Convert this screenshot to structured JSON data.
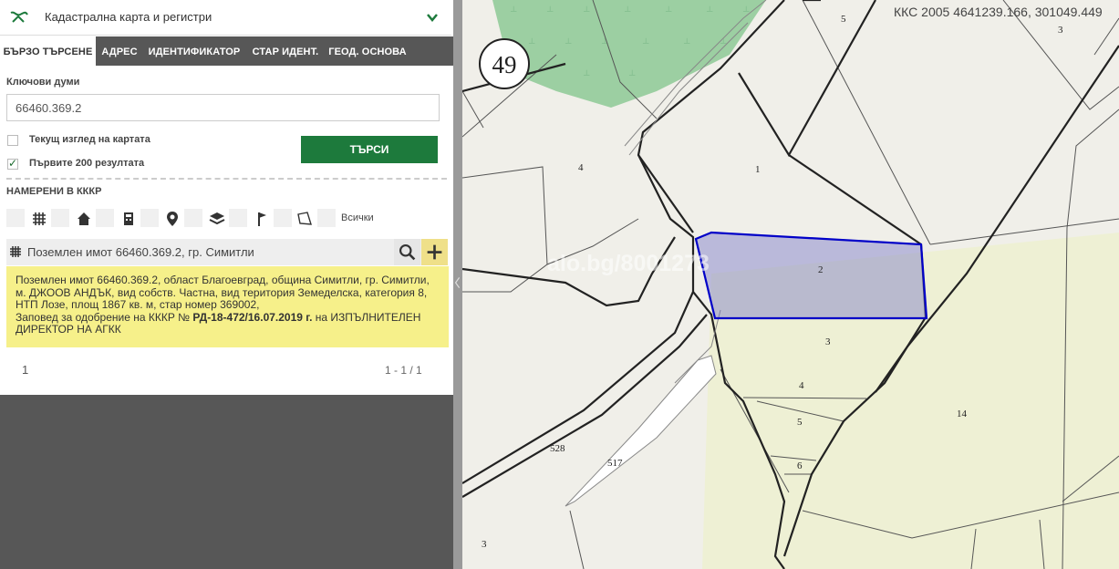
{
  "header": {
    "title": "Кадастрална карта и регистри",
    "logo_icon": "cadastre-logo-icon",
    "dropdown_icon": "chevron-down-icon"
  },
  "tabs": [
    {
      "label": "БЪРЗО ТЪРСЕНЕ",
      "active": true
    },
    {
      "label": "АДРЕС"
    },
    {
      "label": "ИДЕНТИФИКАТОР"
    },
    {
      "label": "СТАР ИДЕНТ."
    },
    {
      "label": "ГЕОД. ОСНОВА"
    }
  ],
  "search": {
    "keywords_label": "Ключови думи",
    "keywords_value": "66460.369.2",
    "current_view_label": "Текущ изглед на картата",
    "current_view_checked": false,
    "first200_label": "Първите 200 резултата",
    "first200_checked": true,
    "button_label": "ТЪРСИ"
  },
  "found": {
    "heading": "НАМЕРЕНИ В КККР",
    "filters": [
      "parcel-grid-icon",
      "building-icon",
      "apartment-icon",
      "address-pin-icon",
      "layers-icon",
      "geodetic-point-icon",
      "polygon-icon"
    ],
    "all_label": "Всички"
  },
  "result": {
    "title": "Поземлен имот 66460.369.2, гр. Симитли",
    "line1": "Поземлен имот 66460.369.2, област Благоевград, община Симитли, гр. Симитли,",
    "line2": "м. ДЖООВ АНДЪК, вид собств. Частна, вид територия Земеделска, категория 8,",
    "line3": "НТП Лозе, площ 1867 кв. м, стар номер 369002,",
    "line4_prefix": "Заповед за одобрение на КККР № ",
    "line4_bold": "РД-18-472/16.07.2019 г.",
    "line4_suffix": " на ИЗПЪЛНИТЕЛЕН",
    "line5": "ДИРЕКТОР НА АГКК"
  },
  "pagination": {
    "page": "1",
    "count": "1 - 1 / 1"
  },
  "map": {
    "coords": "ККС 2005 4641239.166, 301049.449",
    "watermark": "alo.bg/8001273",
    "section_number": "49",
    "parcel_numbers": [
      "5",
      "3",
      "4",
      "1",
      "2",
      "3",
      "4",
      "5",
      "6",
      "14",
      "528",
      "517",
      "3"
    ],
    "highlight_color": "#0000c8",
    "forest_color": "#9ccfa2",
    "vineyard_color": "#eef0d4"
  }
}
